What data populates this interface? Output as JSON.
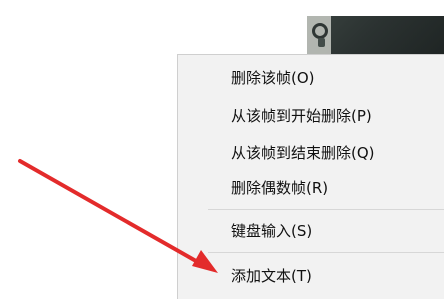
{
  "context_menu": {
    "items": [
      {
        "label": "删除该帧(O)"
      },
      {
        "label": "从该帧到开始删除(P)"
      },
      {
        "label": "从该帧到结束删除(Q)"
      },
      {
        "label": "删除偶数帧(R)"
      },
      {
        "label": "键盘输入(S)"
      },
      {
        "label": "添加文本(T)"
      }
    ]
  },
  "colors": {
    "menu_background": "#f2f2f2",
    "menu_text": "#111111",
    "arrow": "#e32b2b"
  }
}
